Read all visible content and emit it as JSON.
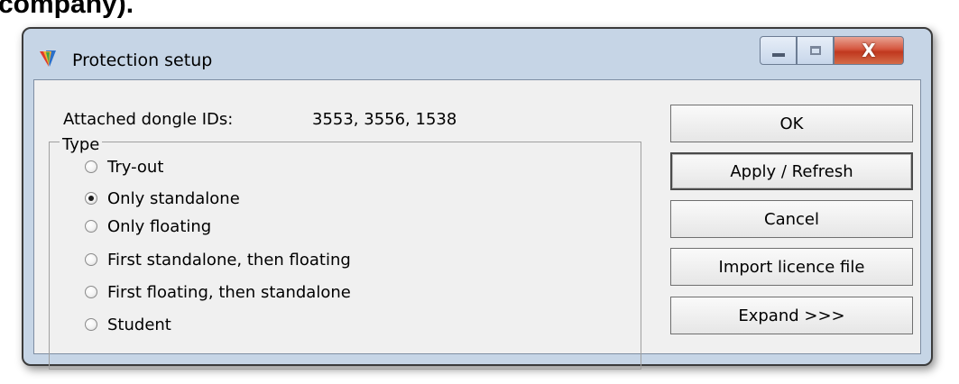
{
  "page": {
    "top_cut_text": "company)."
  },
  "window": {
    "title": "Protection setup",
    "icon": "app-logo-icon",
    "caption_buttons": {
      "minimize": "minimize-icon",
      "maximize": "maximize-icon",
      "close": "X"
    }
  },
  "dongle": {
    "label": "Attached dongle IDs:",
    "value": "3553, 3556, 1538"
  },
  "type_group": {
    "title": "Type",
    "selected_index": 1,
    "options": [
      "Try-out",
      "Only standalone",
      "Only floating",
      "First standalone, then floating",
      "First floating, then standalone",
      "Student"
    ]
  },
  "buttons": {
    "ok": "OK",
    "apply": "Apply / Refresh",
    "cancel": "Cancel",
    "import": "Import licence file",
    "expand": "Expand >>>"
  },
  "colors": {
    "frame": "#c6d5e6",
    "client": "#f0f0f0",
    "close_button": "#c7432a"
  }
}
